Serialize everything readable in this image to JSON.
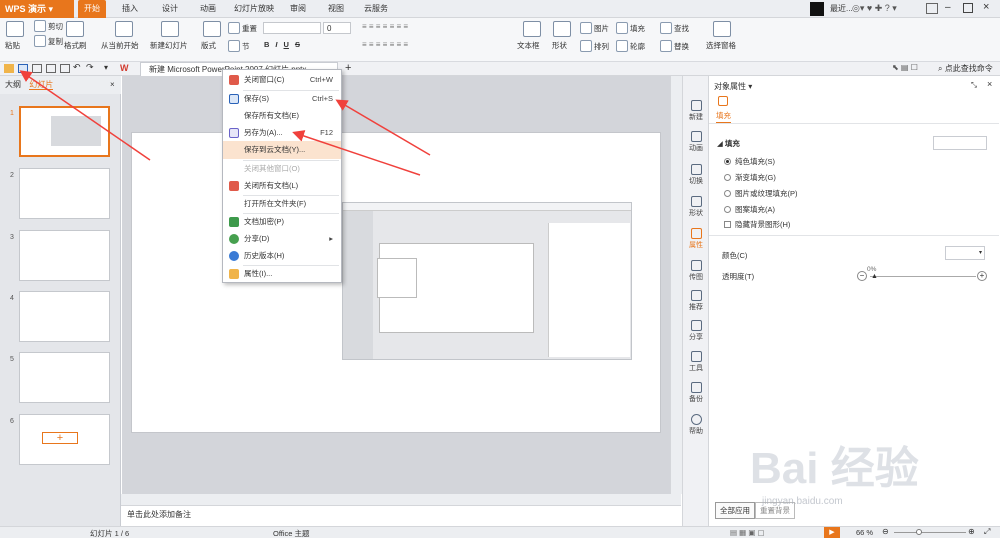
{
  "menubar": {
    "app_name": "WPS 演示",
    "tabs": [
      "开始",
      "插入",
      "设计",
      "动画",
      "幻灯片放映",
      "审阅",
      "视图",
      "云服务"
    ],
    "right_label": "最近..."
  },
  "ribbon": {
    "paste": "粘贴",
    "cut": "剪切",
    "copy": "复制",
    "format_painter": "格式刷",
    "from_start": "从当前开始",
    "new_slide": "新建幻灯片",
    "layout": "版式",
    "reset": "重置",
    "section": "节",
    "font_size": "0",
    "textbox": "文本框",
    "shape": "形状",
    "picture": "图片",
    "fill": "填充",
    "arrange": "排列",
    "outline": "轮廓",
    "find": "查找",
    "replace": "替换",
    "select_pane": "选择窗格",
    "bold": "B",
    "italic": "I",
    "underline": "U",
    "strike": "S"
  },
  "quickbar": {
    "doc_tab": "新建 Microsoft PowerPoint 2007 幻灯片.pptx",
    "find_cmd": "点此查找命令"
  },
  "left_pane": {
    "tab_outline": "大纲",
    "tab_slides": "幻灯片",
    "slides": [
      "1",
      "2",
      "3",
      "4",
      "5",
      "6"
    ],
    "add_label": "+"
  },
  "notes": {
    "placeholder": "单击此处添加备注"
  },
  "context_menu": {
    "items": [
      {
        "label": "关闭窗口(C)",
        "shortcut": "Ctrl+W"
      },
      {
        "label": "保存(S)",
        "shortcut": "Ctrl+S"
      },
      {
        "label": "保存所有文档(E)",
        "shortcut": ""
      },
      {
        "label": "另存为(A)...",
        "shortcut": "F12"
      },
      {
        "label": "保存到云文档(Y)...",
        "shortcut": ""
      },
      {
        "label": "关闭其他窗口(O)",
        "shortcut": ""
      },
      {
        "label": "关闭所有文档(L)",
        "shortcut": ""
      },
      {
        "label": "打开所在文件夹(F)",
        "shortcut": ""
      },
      {
        "label": "文档加密(P)",
        "shortcut": ""
      },
      {
        "label": "分享(D)",
        "shortcut": "▸"
      },
      {
        "label": "历史版本(H)",
        "shortcut": ""
      },
      {
        "label": "属性(I)...",
        "shortcut": ""
      }
    ]
  },
  "sidebar": {
    "items": [
      "新建",
      "动画",
      "切换",
      "形状",
      "属性",
      "传图",
      "推荐",
      "分享",
      "工具",
      "备份",
      "帮助"
    ]
  },
  "properties": {
    "title": "对象属性",
    "fill_tab": "填充",
    "section_fill": "填充",
    "solid": "纯色填充(S)",
    "gradient": "渐变填充(G)",
    "picture_texture": "图片或纹理填充(P)",
    "pattern": "图案填充(A)",
    "hide_bg": "隐藏背景图形(H)",
    "color_label": "颜色(C)",
    "transparency_label": "透明度(T)",
    "transparency_value": "0%",
    "apply_all": "全部应用",
    "reset_bg": "重置背景"
  },
  "statusbar": {
    "slide_pos": "幻灯片 1 / 6",
    "theme": "Office 主题",
    "zoom": "66 %"
  },
  "watermark": "Bai 经验",
  "watermark_url": "jingyan.baidu.com",
  "colors": {
    "accent": "#e8761c",
    "annotation_arrow": "#f0413c"
  }
}
